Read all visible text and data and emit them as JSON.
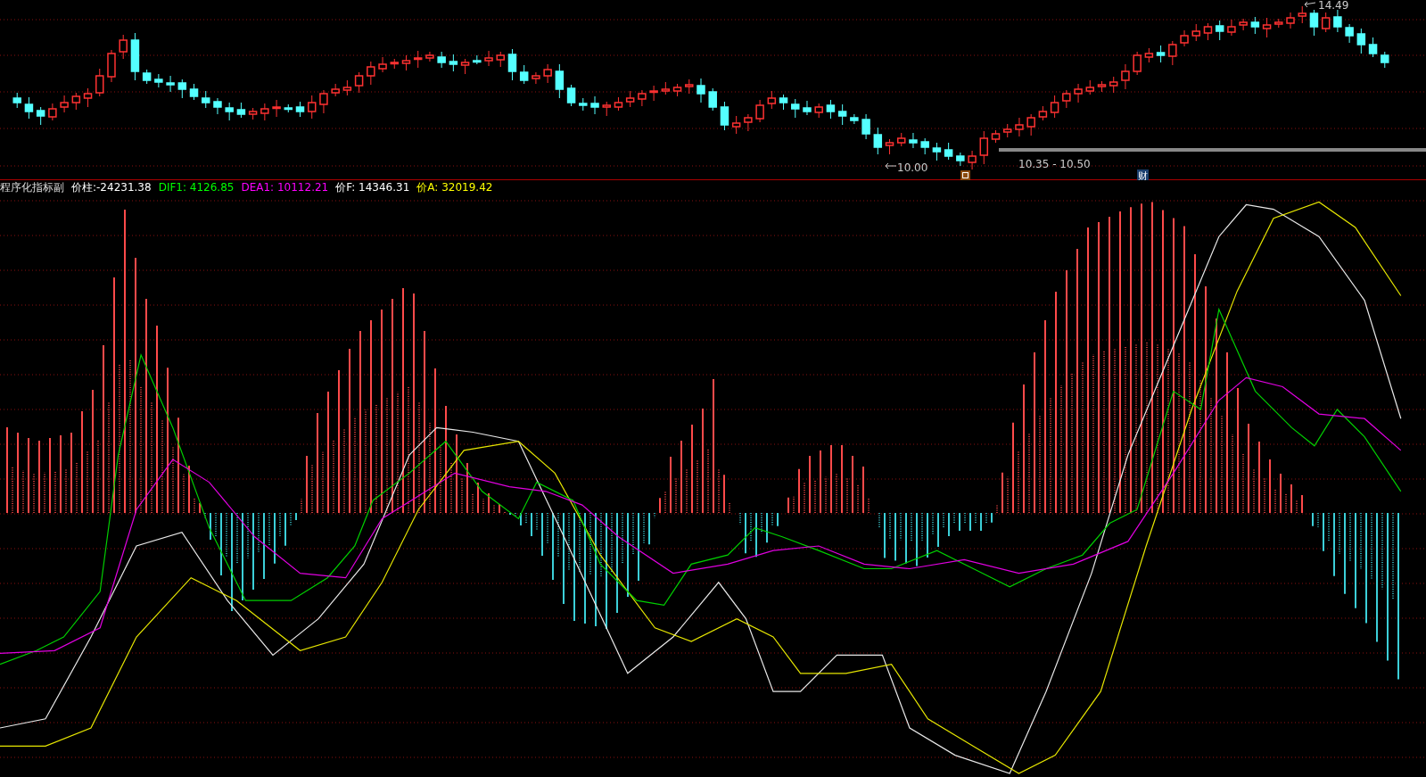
{
  "price_panel": {
    "high_label": "14.49",
    "low_label": "10.00",
    "range_label": "10.35 - 10.50",
    "badge": "财"
  },
  "indicator_panel": {
    "title": "程序化指标副",
    "legend": [
      {
        "label": "价柱:-24231.38",
        "color": "#ffffff"
      },
      {
        "label": "DIF1: 4126.85",
        "color": "#00ff00"
      },
      {
        "label": "DEA1: 10112.21",
        "color": "#ff00ff"
      },
      {
        "label": "价F: 14346.31",
        "color": "#ffffff"
      },
      {
        "label": "价A: 32019.42",
        "color": "#ffff00"
      }
    ]
  }
}
